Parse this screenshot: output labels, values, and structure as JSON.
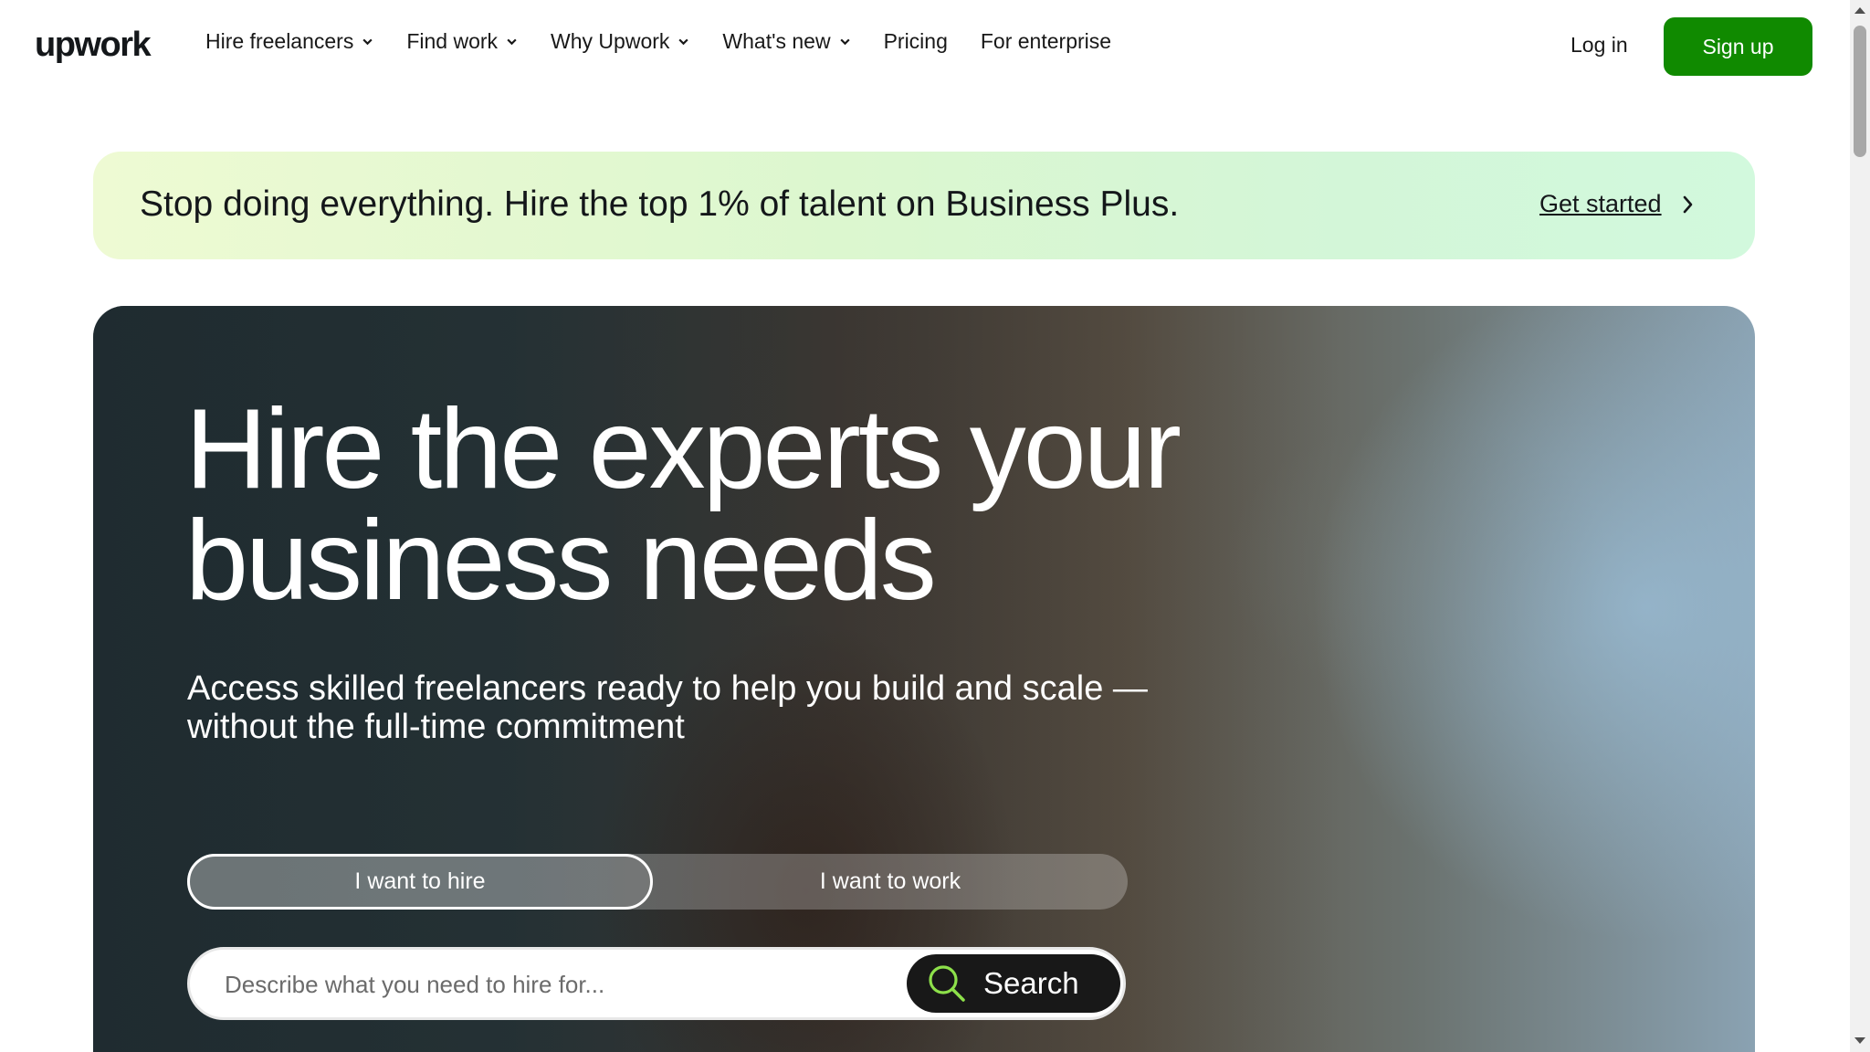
{
  "header": {
    "logo": "upwork",
    "nav": [
      {
        "label": "Hire freelancers",
        "has_dropdown": true
      },
      {
        "label": "Find work",
        "has_dropdown": true
      },
      {
        "label": "Why Upwork",
        "has_dropdown": true
      },
      {
        "label": "What's new",
        "has_dropdown": true
      },
      {
        "label": "Pricing",
        "has_dropdown": false
      },
      {
        "label": "For enterprise",
        "has_dropdown": false
      }
    ],
    "login_label": "Log in",
    "signup_label": "Sign up"
  },
  "banner": {
    "text": "Stop doing everything. Hire the top 1% of talent on Business Plus.",
    "link_label": "Get started"
  },
  "hero": {
    "title": "Hire the experts your business needs",
    "subtitle": "Access skilled freelancers ready to help you build and scale — without the full-time commitment",
    "toggle": {
      "options": [
        "I want to hire",
        "I want to work"
      ],
      "selected": "I want to hire"
    },
    "search": {
      "placeholder": "Describe what you need to hire for...",
      "value": "",
      "button_label": "Search"
    }
  },
  "colors": {
    "brand_green": "#108a00",
    "text_dark": "#181818",
    "search_button": "#181818"
  },
  "icons": [
    "chevron-down-icon",
    "chevron-right-icon",
    "search-icon"
  ]
}
